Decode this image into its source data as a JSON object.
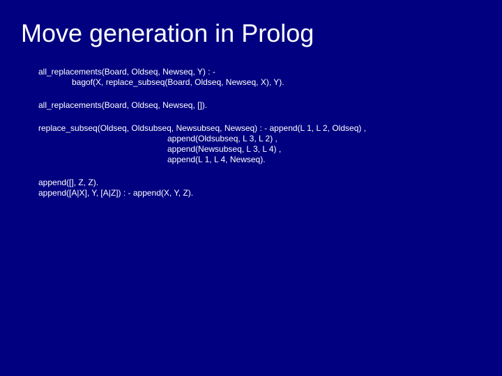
{
  "title": "Move generation in Prolog",
  "clauses": {
    "c1_l1": "all_replacements(Board, Oldseq, Newseq, Y) : -",
    "c1_l2": "bagof(X, replace_subseq(Board, Oldseq, Newseq, X), Y).",
    "c2_l1": "all_replacements(Board, Oldseq, Newseq, []).",
    "c3_l1": "replace_subseq(Oldseq, Oldsubseq, Newsubseq, Newseq) : - append(L 1, L 2, Oldseq) ,",
    "c3_l2": "append(Oldsubseq, L 3, L 2) ,",
    "c3_l3": "append(Newsubseq, L 3, L 4) ,",
    "c3_l4": "append(L 1, L 4, Newseq).",
    "c4_l1": "append([], Z, Z).",
    "c4_l2": "append([A|X], Y, [A|Z]) : - append(X, Y, Z)."
  }
}
